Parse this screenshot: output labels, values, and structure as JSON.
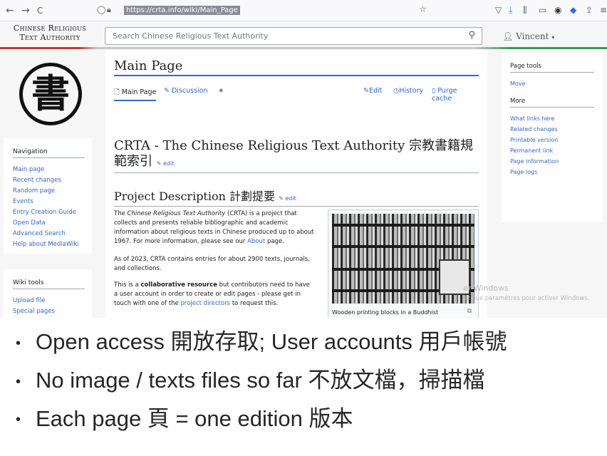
{
  "browser": {
    "back_icon": "←",
    "forward_icon": "→",
    "reload_icon": "C",
    "url": "https://crta.info/wiki/Main_Page"
  },
  "site": {
    "logo_line1": "Chinese Religious",
    "logo_line2": "Text Authority",
    "search_placeholder": "Search Chinese Religious Text Authority",
    "user_name": "Vincent",
    "emblem_char": "書"
  },
  "navigation": {
    "heading": "Navigation",
    "items": [
      "Main page",
      "Recent changes",
      "Random page",
      "Events",
      "Entry Creation Guide",
      "Open Data",
      "Advanced Search",
      "Help about MediaWiki"
    ]
  },
  "wiki_tools": {
    "heading": "Wiki tools",
    "items": [
      "Upload file",
      "Special pages"
    ]
  },
  "page": {
    "title": "Main Page",
    "tabs": {
      "main_page": "Main Page",
      "discussion": "Discussion",
      "edit": "Edit",
      "history": "History",
      "purge": "Purge cache"
    },
    "heading": "CRTA - The Chinese Religious Text Authority 宗教書籍規範索引",
    "heading_edit": "edit",
    "section": "Project Description 計劃提要",
    "section_edit": "edit",
    "p1_a": "The ",
    "p1_em": "Chinese Religious Text Authority",
    "p1_b": " (CRTA) is a project that collects and presents reliable bibliographic and academic information about religious texts in Chinese produced up to about 1967. For more information, please see our ",
    "p1_link": "About",
    "p1_c": " page.",
    "p2": "As of 2023, CRTA contains entries for about 2900 texts, journals, and collections.",
    "p3_a": "This is a ",
    "p3_b": "collaborative resource",
    "p3_c": " but contributors need to have a user account in order to create or edit pages - please get in touch with one of the ",
    "p3_link": "project directors",
    "p3_d": " to request this.",
    "figure_caption": "Wooden printing blocks in a Buddhist"
  },
  "page_tools": {
    "heading": "Page tools",
    "move": "Move",
    "more_heading": "More",
    "items": [
      "What links here",
      "Related changes",
      "Printable version",
      "Permanent link",
      "Page information",
      "Page logs"
    ]
  },
  "watermark": {
    "line1": "er Windows",
    "line2": "ez aux paramètres pour activer Windows."
  },
  "bullets": [
    "Open access 開放存取; User accounts 用戶帳號",
    "No image / texts files so far 不放文檔，掃描檔",
    "Each page 頁 = one edition 版本"
  ]
}
